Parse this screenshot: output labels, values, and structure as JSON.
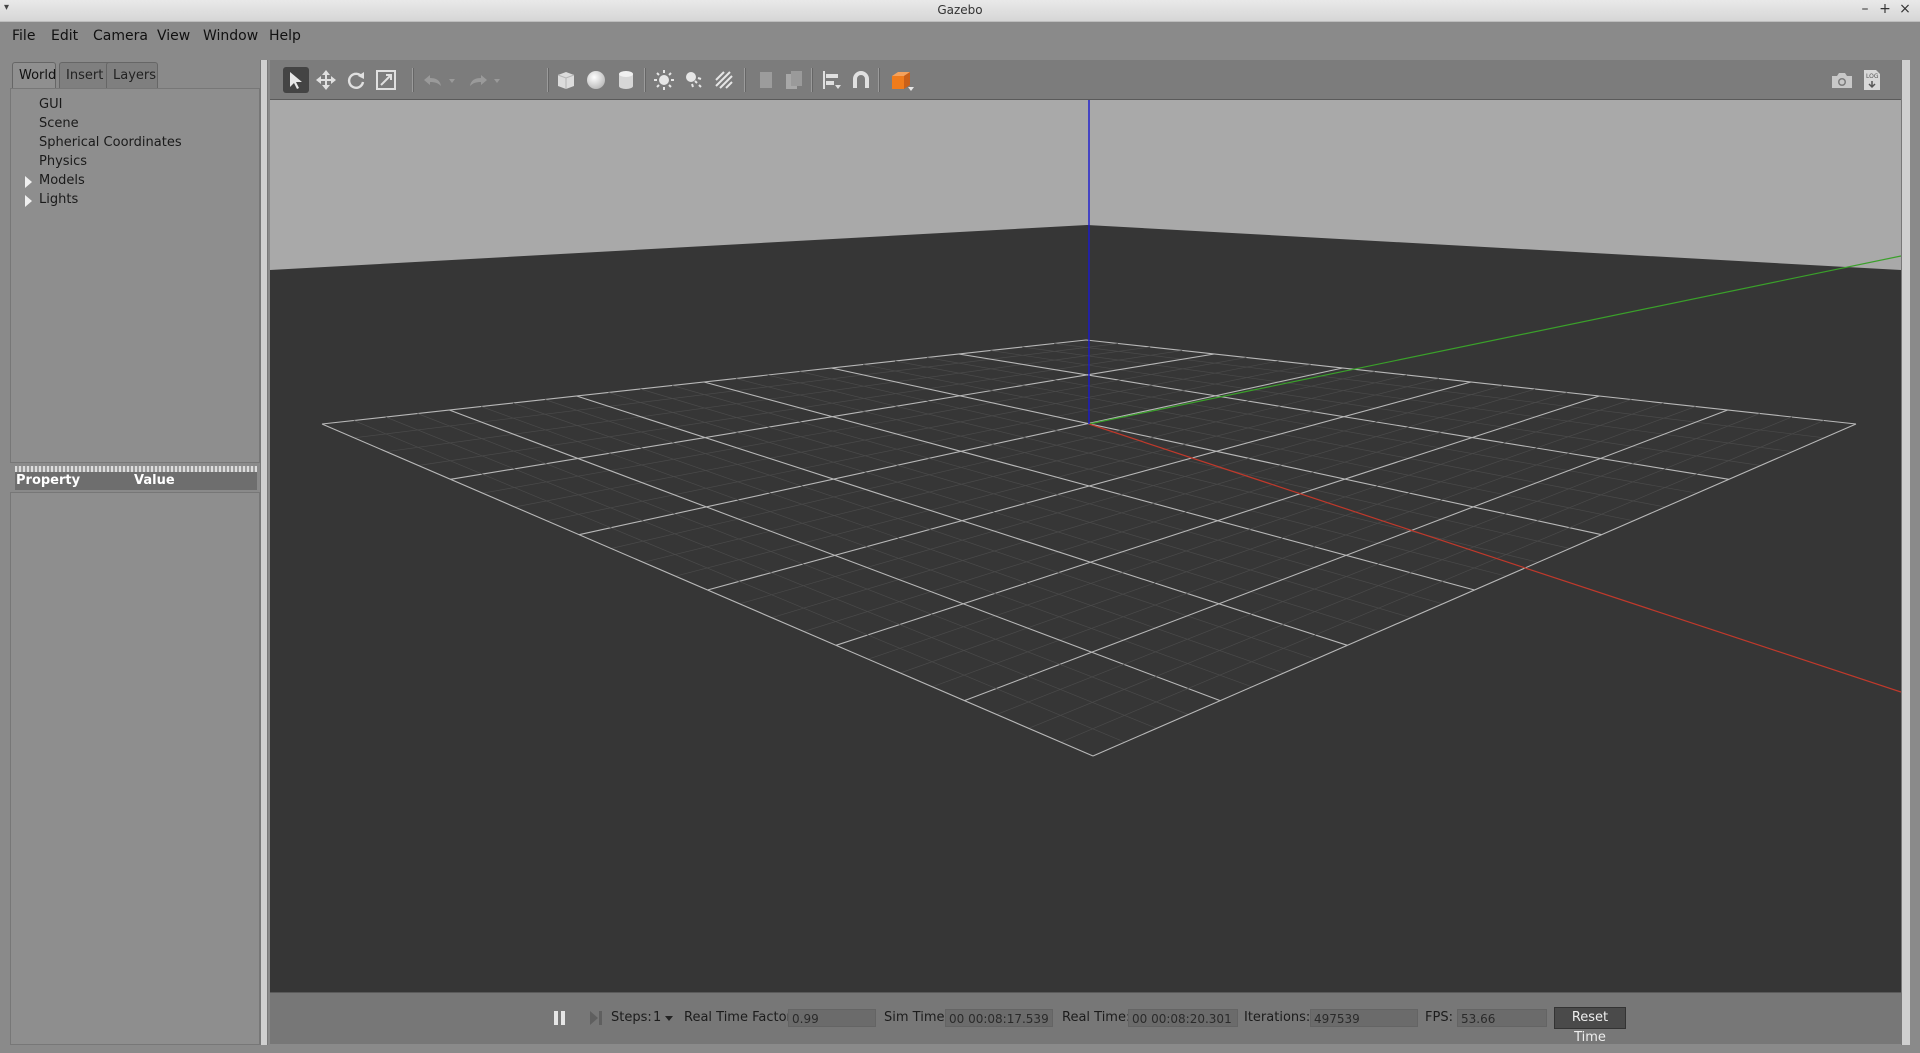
{
  "window": {
    "title": "Gazebo"
  },
  "menu": {
    "items": [
      "File",
      "Edit",
      "Camera",
      "View",
      "Window",
      "Help"
    ]
  },
  "left_panel": {
    "tabs": [
      {
        "label": "World",
        "active": true
      },
      {
        "label": "Insert",
        "active": false
      },
      {
        "label": "Layers",
        "active": false
      }
    ],
    "tree": [
      {
        "label": "GUI",
        "expandable": false
      },
      {
        "label": "Scene",
        "expandable": false
      },
      {
        "label": "Spherical Coordinates",
        "expandable": false
      },
      {
        "label": "Physics",
        "expandable": false
      },
      {
        "label": "Models",
        "expandable": true
      },
      {
        "label": "Lights",
        "expandable": true
      }
    ],
    "property_header": {
      "property": "Property",
      "value": "Value"
    }
  },
  "toolbar": {
    "tools": [
      "select-mode-icon",
      "translate-mode-icon",
      "rotate-mode-icon",
      "scale-mode-icon",
      "undo-icon",
      "undo-history-icon",
      "redo-icon",
      "redo-history-icon",
      "box-shape-icon",
      "sphere-shape-icon",
      "cylinder-shape-icon",
      "point-light-icon",
      "spot-light-icon",
      "directional-light-icon",
      "copy-icon",
      "paste-icon",
      "align-icon",
      "snap-icon",
      "view-angle-icon",
      "screenshot-icon",
      "log-icon"
    ],
    "selected": "select-mode-icon",
    "view_angle_color": "#f07c1c"
  },
  "viewport": {
    "sky_color": "#a9a9a9",
    "ground_color": "#363636",
    "axis_colors": {
      "x": "#c0392b",
      "y": "#3aa02a",
      "z": "#1a1ad0"
    }
  },
  "bottom_bar": {
    "steps_label": "Steps:",
    "steps_value": "1",
    "real_time_factor_label": "Real Time Factor:",
    "real_time_factor": "0.99",
    "sim_time_label": "Sim Time:",
    "sim_time": "00 00:08:17.539",
    "real_time_label": "Real Time:",
    "real_time": "00 00:08:20.301",
    "iterations_label": "Iterations:",
    "iterations": "497539",
    "fps_label": "FPS:",
    "fps": "53.66",
    "reset_label": "Reset Time"
  }
}
